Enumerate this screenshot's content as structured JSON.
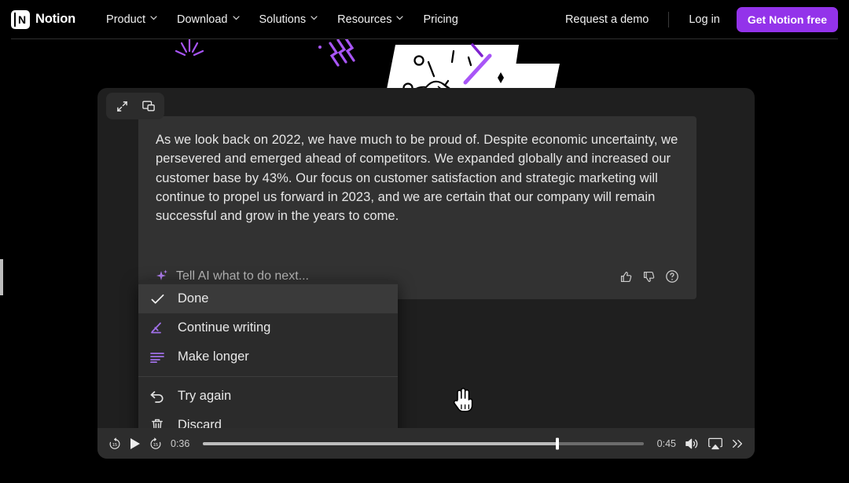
{
  "navbar": {
    "brand": "Notion",
    "logo_icon": "notion-logo-icon",
    "links": [
      {
        "label": "Product",
        "has_chevron": true
      },
      {
        "label": "Download",
        "has_chevron": true
      },
      {
        "label": "Solutions",
        "has_chevron": true
      },
      {
        "label": "Resources",
        "has_chevron": true
      },
      {
        "label": "Pricing",
        "has_chevron": false
      }
    ],
    "request_demo": "Request a demo",
    "login": "Log in",
    "cta": "Get Notion free",
    "cta_color": "#9333ea"
  },
  "video_panel": {
    "top_controls": [
      {
        "icon": "expand-fullscreen-icon"
      },
      {
        "icon": "picture-in-picture-icon"
      }
    ],
    "ai_response": "As we look back on 2022, we have much to be proud of. Despite economic uncertainty, we persevered and emerged ahead of competitors. We expanded globally and increased our customer base by 43%. Our focus on customer satisfaction and strategic marketing will continue to propel us forward in 2023, and we are certain that our company will remain successful and grow in the years to come.",
    "prompt_placeholder": "Tell AI what to do next...",
    "sparkle_icon": "ai-sparkle-icon",
    "sparkle_color": "#b07ef0",
    "feedback_icons": [
      "thumbs-up-icon",
      "thumbs-down-icon",
      "help-circle-icon"
    ],
    "menu": {
      "items": [
        {
          "label": "Done",
          "icon": "checkmark-icon",
          "active": true,
          "accent": false
        },
        {
          "label": "Continue writing",
          "icon": "pen-icon",
          "active": false,
          "accent": true
        },
        {
          "label": "Make longer",
          "icon": "text-lines-icon",
          "active": false,
          "accent": true
        }
      ],
      "items_secondary": [
        {
          "label": "Try again",
          "icon": "undo-arrow-icon",
          "active": false,
          "accent": false
        },
        {
          "label": "Discard",
          "icon": "trash-icon",
          "active": false,
          "accent": false
        }
      ]
    },
    "controls": {
      "rewind_icon": "rewind-15-icon",
      "play_icon": "play-icon",
      "forward_icon": "forward-15-icon",
      "current_time": "0:36",
      "total_time": "0:45",
      "progress_percent": 80.5,
      "volume_icon": "volume-on-icon",
      "airplay_icon": "airplay-icon",
      "more_icon": "chevron-double-right-icon"
    }
  }
}
